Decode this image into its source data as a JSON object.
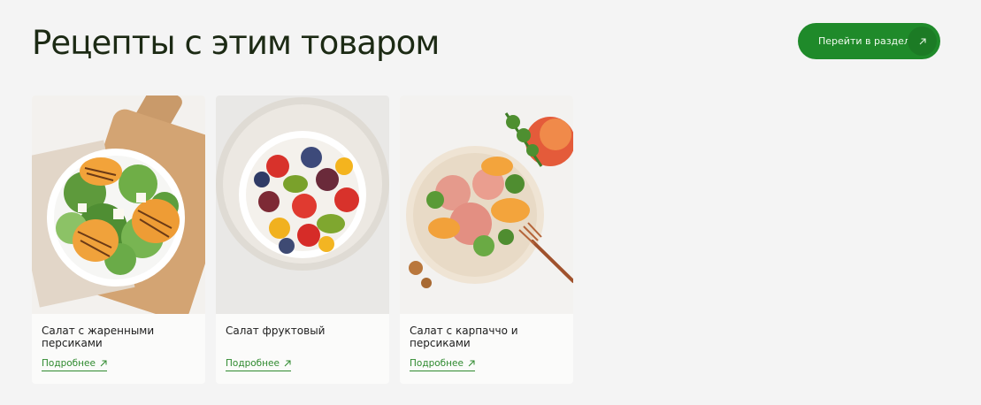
{
  "section": {
    "title": "Рецепты с этим товаром",
    "button_label": "Перейти в раздел"
  },
  "colors": {
    "accent": "#1f8a2a",
    "link": "#2f8a2f",
    "background": "#f4f4f4",
    "card": "#fbfbfa"
  },
  "cards": [
    {
      "title": "Салат с жаренными персиками",
      "link": "Подробнее",
      "image": "grilled-peach-salad-photo"
    },
    {
      "title": "Салат фруктовый",
      "link": "Подробнее",
      "image": "fruit-salad-photo"
    },
    {
      "title": "Салат с карпаччо и персиками",
      "link": "Подробнее",
      "image": "carpaccio-peach-salad-photo"
    }
  ]
}
